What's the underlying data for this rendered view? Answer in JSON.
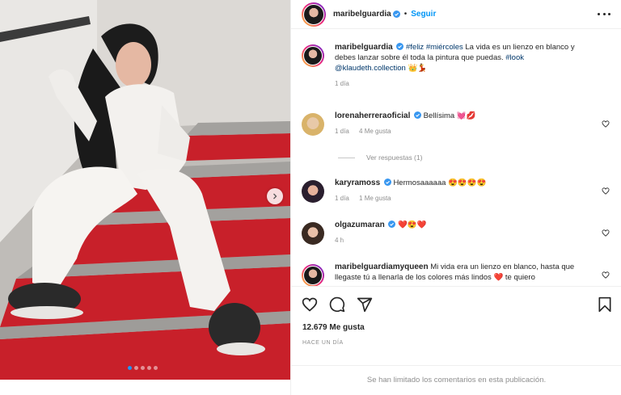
{
  "post": {
    "author": "maribelguardia",
    "separator": "•",
    "follow_label": "Seguir",
    "caption": {
      "hashtag_1": "#feliz",
      "hashtag_2": "#miércoles",
      "text": "La vida es un lienzo en blanco y debes lanzar sobre él toda la pintura que puedas.",
      "hashtag_3": "#look",
      "mention": "@klaudeth.collection",
      "emojis": "👑💃",
      "time": "1 día"
    },
    "carousel": {
      "slide_count": 5,
      "active_index": 0
    }
  },
  "comments": [
    {
      "user": "lorenaherreraoficial",
      "verified": true,
      "text": "Bellísima 💓💋",
      "time": "1 día",
      "likes": "4 Me gusta"
    },
    {
      "user": "karyramoss",
      "verified": true,
      "text": "Hermosaaaaaa 😍😍😍😍",
      "time": "1 día",
      "likes": "1 Me gusta"
    },
    {
      "user": "olgazumaran",
      "verified": true,
      "text": "❤️😍❤️",
      "time": "4 h",
      "likes": ""
    },
    {
      "user": "maribelguardiamyqueen",
      "verified": false,
      "text": "Mi vida era un lienzo en blanco, hasta que llegaste tú a llenarla de los colores más lindos ❤️ te quiero",
      "time": "",
      "likes": ""
    }
  ],
  "replies_label": "Ver respuestas (1)",
  "likes_count": "12.679 Me gusta",
  "posted_ago": "HACE UN DÍA",
  "comments_limited": "Se han limitado los comentarios en esta publicación.",
  "icons": [
    "more-icon",
    "heart-icon",
    "comment-icon",
    "share-icon",
    "bookmark-icon",
    "verified-icon",
    "chevron-right-icon"
  ],
  "colors": {
    "accent": "#0095f6",
    "verified": "#3897f0",
    "stairs_red": "#c8202a"
  }
}
